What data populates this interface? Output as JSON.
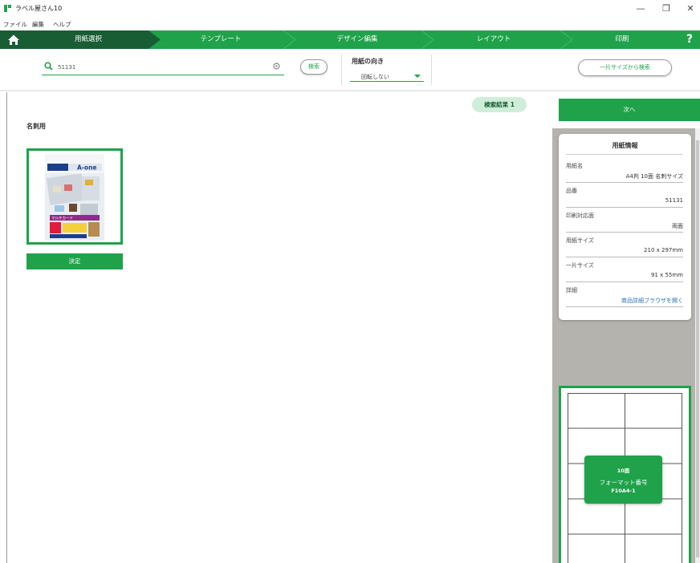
{
  "window": {
    "title": "ラベル屋さん10",
    "controls": {
      "minimize": "—",
      "restore": "❐",
      "close": "✕"
    }
  },
  "menu": [
    "ファイル",
    "編集",
    "ヘルプ"
  ],
  "steps": [
    {
      "label": "用紙選択",
      "active": true
    },
    {
      "label": "テンプレート",
      "active": false
    },
    {
      "label": "デザイン編集",
      "active": false
    },
    {
      "label": "レイアウト",
      "active": false
    },
    {
      "label": "印刷",
      "active": false
    }
  ],
  "help_label": "?",
  "search": {
    "value": "51131",
    "button_label": "検索"
  },
  "orientation": {
    "label": "用紙の向き",
    "selected": "回転しない"
  },
  "size_search_label": "一片サイズから検索",
  "result_badge": "検索結果 1",
  "category": "名刺用",
  "product": {
    "brand": "A-one",
    "thumb_caption": "マルチカード",
    "decide_label": "決定"
  },
  "next_label": "次へ",
  "paper_info": {
    "title": "用紙情報",
    "rows": [
      {
        "key": "用紙名",
        "value": "A4判 10面 名刺サイズ"
      },
      {
        "key": "品番",
        "value": "51131"
      },
      {
        "key": "印刷対応面",
        "value": "両面"
      },
      {
        "key": "用紙サイズ",
        "value": "210 x 297mm"
      },
      {
        "key": "一片サイズ",
        "value": "91 x 55mm"
      },
      {
        "key": "詳細",
        "value": "商品詳細ブラウザを開く"
      }
    ]
  },
  "format_badge": {
    "faces": "10面",
    "label": "フォーマット番号",
    "code": "F10A4-1"
  },
  "colors": {
    "brand_green": "#1fa24a",
    "active_step": "#195d34",
    "panel_gray": "#b5b3ad",
    "link_blue": "#2f6fb5"
  }
}
